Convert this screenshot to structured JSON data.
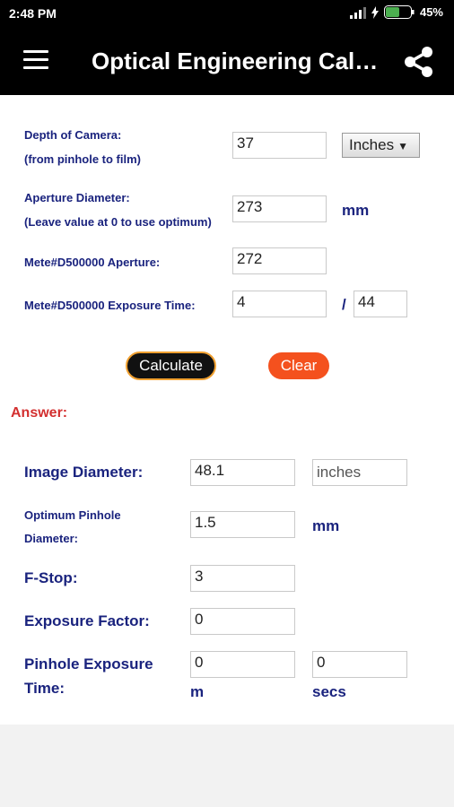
{
  "status_bar": {
    "time": "2:48 PM",
    "battery": "45%"
  },
  "toolbar": {
    "title": "Optical Engineering Cal…"
  },
  "inputs": {
    "depth_label_1": "Depth of Camera:",
    "depth_label_2": "(from pinhole to film)",
    "depth_value": "37",
    "unit_select": "Inches",
    "aperture_label_1": "Aperture Diameter:",
    "aperture_label_2": "(Leave value at 0 to use optimum)",
    "aperture_value": "273",
    "aperture_unit": "mm",
    "meter_aperture_label": "Mete#D500000 Aperture:",
    "meter_aperture_value": "272",
    "meter_exposure_label": "Mete#D500000 Exposure Time:",
    "exposure_num": "4",
    "exposure_slash": "/",
    "exposure_den": "44"
  },
  "buttons": {
    "calculate": "Calculate",
    "clear": "Clear"
  },
  "answer_label": "Answer:",
  "results": {
    "image_diameter_label": "Image Diameter:",
    "image_diameter_value": "48.1",
    "image_diameter_unit": "inches",
    "pinhole_label_1": "Optimum Pinhole",
    "pinhole_label_2": "Diameter:",
    "pinhole_value": "1.5",
    "pinhole_unit": "mm",
    "fstop_label": "F-Stop:",
    "fstop_value": "3",
    "exposure_factor_label": "Exposure Factor:",
    "exposure_factor_value": "0",
    "pinhole_exposure_label_1": "Pinhole Exposure",
    "pinhole_exposure_label_2": "Time:",
    "minutes_value": "0",
    "minutes_unit": "m",
    "seconds_value": "0",
    "seconds_unit": "secs"
  }
}
